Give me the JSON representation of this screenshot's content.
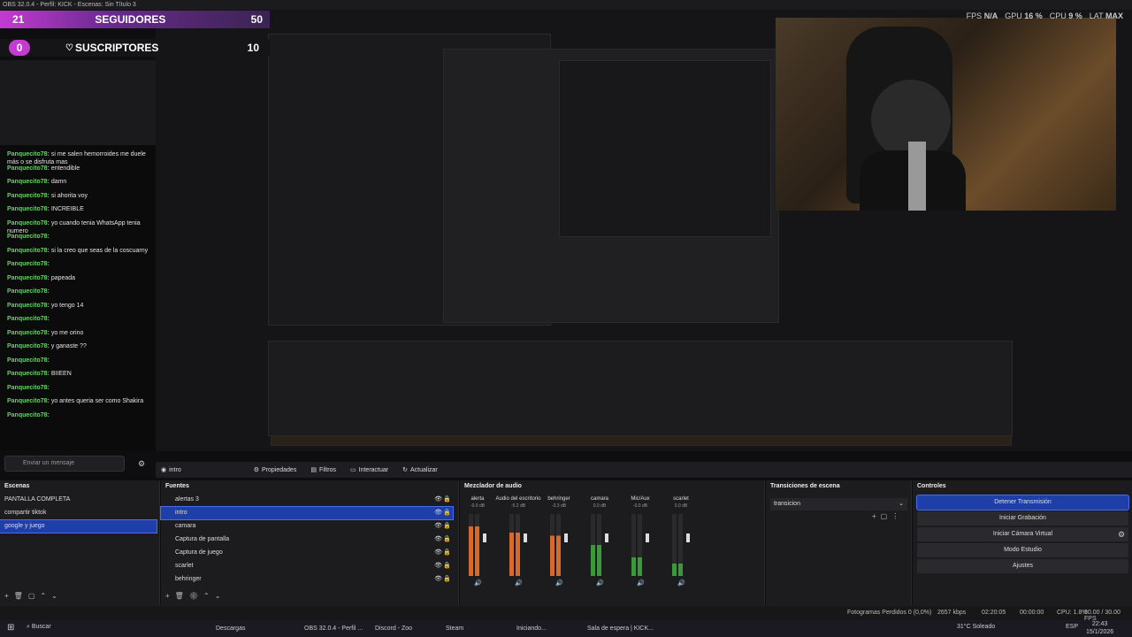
{
  "window": {
    "title": "OBS 32.0.4 - Perfil: KICK - Escenas: Sin Título 3"
  },
  "stats": {
    "fps_label": "FPS",
    "fps": "N/A",
    "gpu_label": "GPU",
    "gpu": "16 %",
    "cpu_label": "CPU",
    "cpu": "9 %",
    "lat_label": "LAT",
    "lat": "MAX"
  },
  "counters": {
    "followers_label": "SEGUIDORES",
    "followers_count": "21",
    "followers_goal": "50",
    "subs_label": "SUSCRIPTORES",
    "subs_count": "0",
    "subs_goal": "10"
  },
  "chat": {
    "messages": [
      {
        "user": "Panquecito78:",
        "text": "si me salen hemorroides me duele más o se disfruta mas"
      },
      {
        "user": "Panquecito78:",
        "text": "entendible"
      },
      {
        "user": "Panquecito78:",
        "text": "damn"
      },
      {
        "user": "Panquecito78:",
        "text": "si ahorita voy"
      },
      {
        "user": "Panquecito78:",
        "text": "INCREIBLE"
      },
      {
        "user": "Panquecito78:",
        "text": "yo cuando tenia WhatsApp tenia numero"
      },
      {
        "user": "Panquecito78:",
        "text": ""
      },
      {
        "user": "Panquecito78:",
        "text": "si la creo que seas de la coscuarny"
      },
      {
        "user": "Panquecito78:",
        "text": ""
      },
      {
        "user": "Panquecito78:",
        "text": "papeada"
      },
      {
        "user": "Panquecito78:",
        "text": ""
      },
      {
        "user": "Panquecito78:",
        "text": "yo tengo 14"
      },
      {
        "user": "Panquecito78:",
        "text": ""
      },
      {
        "user": "Panquecito78:",
        "text": "yo me orino"
      },
      {
        "user": "Panquecito78:",
        "text": "y ganaste ??"
      },
      {
        "user": "Panquecito78:",
        "text": ""
      },
      {
        "user": "Panquecito78:",
        "text": "BIIEEN"
      },
      {
        "user": "Panquecito78:",
        "text": ""
      },
      {
        "user": "Panquecito78:",
        "text": "yo antes queria ser como Shakira"
      },
      {
        "user": "Panquecito78:",
        "text": ""
      }
    ],
    "input_placeholder": "Enviar un mensaje"
  },
  "toolbar": {
    "scene_name": "intro",
    "properties": "Propiedades",
    "filters": "Filtros",
    "interact": "Interactuar",
    "refresh": "Actualizar"
  },
  "scenes": {
    "title": "Escenas",
    "items": [
      "PANTALLA COMPLETA",
      "compartir tiktok",
      "google y juego"
    ],
    "selected": 2
  },
  "sources": {
    "title": "Fuentes",
    "items": [
      "alertas 3",
      "intro",
      "camara",
      "Captura de pantalla",
      "Captura de juego",
      "scarlet",
      "behringer"
    ],
    "selected": 1
  },
  "mixer": {
    "title": "Mezclador de audio",
    "channels": [
      {
        "name": "alerta",
        "db": "-0.0 dB",
        "level": 0.8
      },
      {
        "name": "Audio del escritorio",
        "db": "-5.2 dB",
        "level": 0.7
      },
      {
        "name": "behringer",
        "db": "-3.3 dB",
        "level": 0.65
      },
      {
        "name": "camara",
        "db": "0.0 dB",
        "level": 0.5
      },
      {
        "name": "Mic/Aux",
        "db": "-0.0 dB",
        "level": 0.3
      },
      {
        "name": "scarlet",
        "db": "0.0 dB",
        "level": 0.2
      }
    ]
  },
  "transitions": {
    "title": "Transiciones de escena",
    "selected": "transicion"
  },
  "controls": {
    "title": "Controles",
    "buttons": [
      "Detener Transmisión",
      "Iniciar Grabación",
      "Iniciar Cámara Virtual",
      "Modo Estudio",
      "Ajustes"
    ]
  },
  "status": {
    "dropped": "Fotogramas Perdidos 0 (0,0%)",
    "bitrate": "2657 kbps",
    "time": "02:20:05",
    "rec": "00:00:00",
    "cpu": "CPU: 1.8%",
    "fps": "30.00 / 30.00 FPS"
  },
  "taskbar": {
    "search": "Buscar",
    "apps": [
      "Descargas",
      "OBS 32.0.4 - Perfil ...",
      "Discord - Zoo",
      "Steam",
      "Iniciando...",
      "Sala de espera | KICK..."
    ],
    "weather": "31°C Soleado",
    "clock": "22:43",
    "date": "15/1/2026",
    "lang": "ESP"
  }
}
